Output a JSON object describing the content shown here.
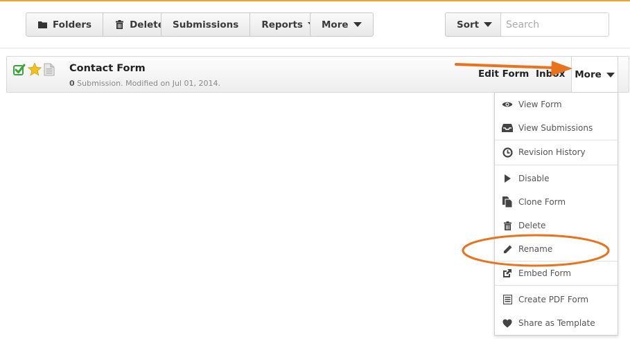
{
  "toolbar": {
    "folders_label": "Folders",
    "delete_label": "Delete",
    "submissions_label": "Submissions",
    "reports_label": "Reports",
    "more_label": "More",
    "sort_label": "Sort",
    "search_placeholder": "Search"
  },
  "form": {
    "title": "Contact Form",
    "submission_count": "0",
    "meta_text": " Submission. Modified on Jul 01, 2014.",
    "edit_label": "Edit Form",
    "inbox_label": "Inbox",
    "more_label": "More"
  },
  "menu": {
    "items": [
      {
        "label": "View Form",
        "icon": "eye-icon"
      },
      {
        "label": "View Submissions",
        "icon": "inbox-icon"
      },
      {
        "label": "Revision History",
        "icon": "history-icon"
      },
      {
        "label": "Disable",
        "icon": "play-icon"
      },
      {
        "label": "Clone Form",
        "icon": "copy-icon"
      },
      {
        "label": "Delete",
        "icon": "trash-icon"
      },
      {
        "label": "Rename",
        "icon": "pencil-icon"
      },
      {
        "label": "Embed Form",
        "icon": "share-icon"
      },
      {
        "label": "Create PDF Form",
        "icon": "list-icon"
      },
      {
        "label": "Share as Template",
        "icon": "heart-icon"
      }
    ]
  },
  "colors": {
    "accent": "#f0a030",
    "annotation": "#e8731c",
    "check": "#3aa63a",
    "star": "#f2c01a"
  }
}
